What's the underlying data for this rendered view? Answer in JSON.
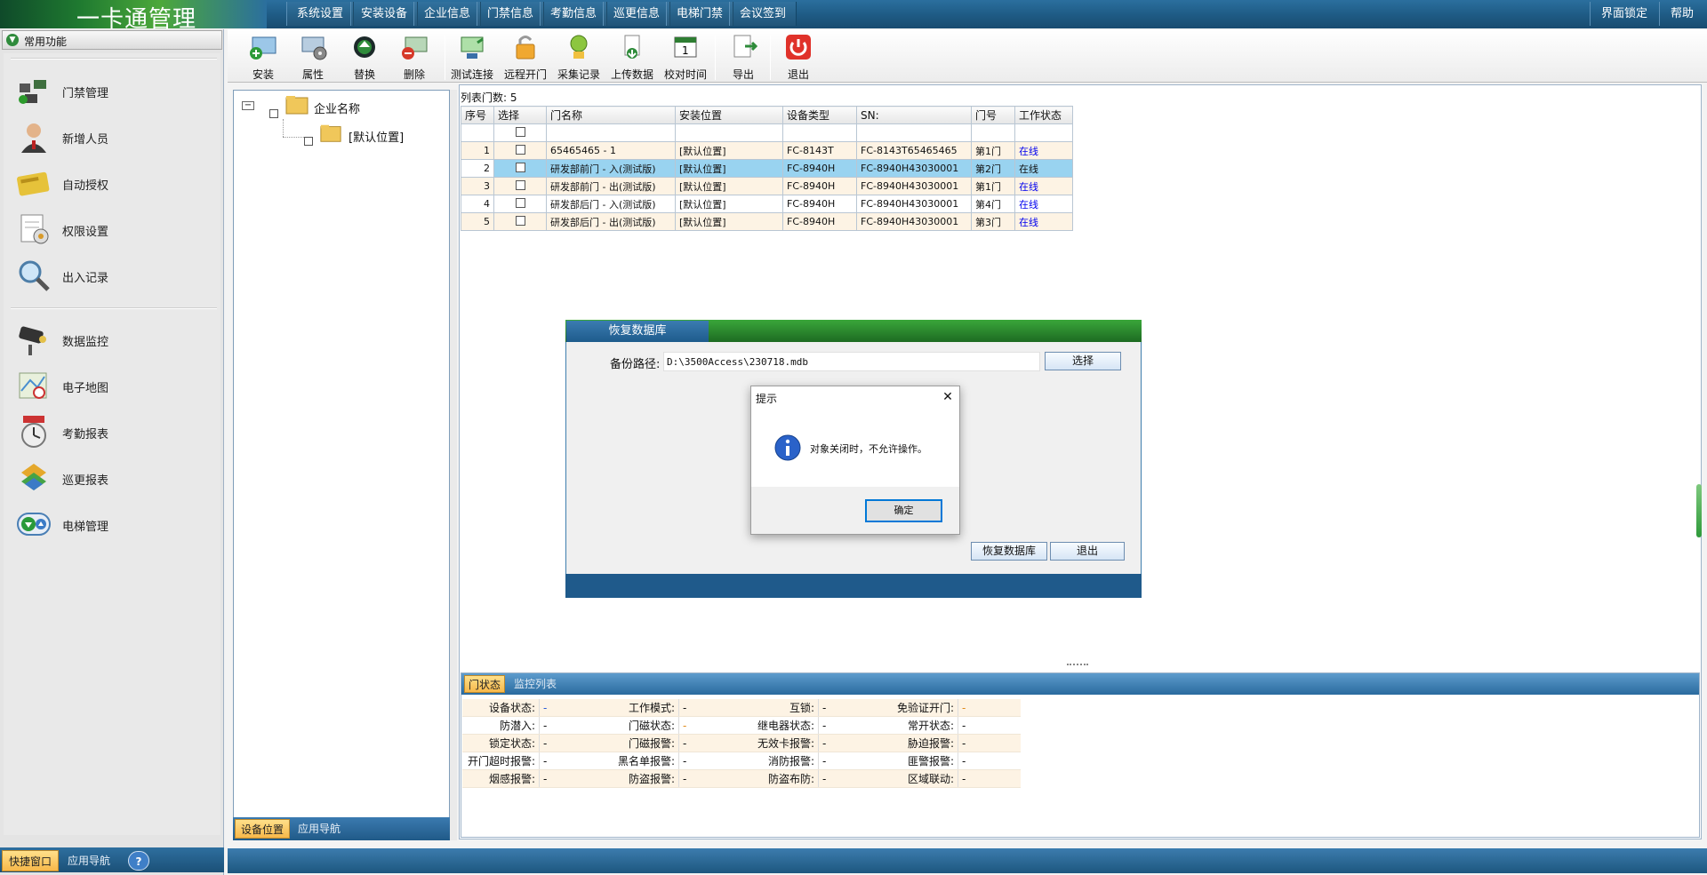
{
  "app": {
    "title": "一卡通管理"
  },
  "topmenu": [
    "系统设置",
    "安装设备",
    "企业信息",
    "门禁信息",
    "考勤信息",
    "巡更信息",
    "电梯门禁",
    "会议签到"
  ],
  "topright": [
    "界面锁定",
    "帮助"
  ],
  "sidebar": {
    "header": "常用功能",
    "items": [
      {
        "label": "门禁管理",
        "icon": "door-access-icon"
      },
      {
        "label": "新增人员",
        "icon": "person-icon"
      },
      {
        "label": "自动授权",
        "icon": "card-icon"
      },
      {
        "label": "权限设置",
        "icon": "permission-icon"
      },
      {
        "label": "出入记录",
        "icon": "magnifier-icon"
      },
      {
        "label": "数据监控",
        "icon": "camera-icon"
      },
      {
        "label": "电子地图",
        "icon": "map-icon"
      },
      {
        "label": "考勤报表",
        "icon": "clock-icon"
      },
      {
        "label": "巡更报表",
        "icon": "patrol-icon"
      },
      {
        "label": "电梯管理",
        "icon": "elevator-icon"
      }
    ],
    "bottom_tabs": [
      "快捷窗口",
      "应用导航"
    ],
    "help": "?"
  },
  "toolbar": [
    {
      "label": "安装",
      "icon": "install-icon"
    },
    {
      "label": "属性",
      "icon": "properties-icon"
    },
    {
      "label": "替换",
      "icon": "replace-icon"
    },
    {
      "label": "删除",
      "icon": "delete-icon"
    },
    {
      "label": "测试连接",
      "icon": "test-connection-icon"
    },
    {
      "label": "远程开门",
      "icon": "remote-open-icon"
    },
    {
      "label": "采集记录",
      "icon": "collect-icon"
    },
    {
      "label": "上传数据",
      "icon": "upload-icon"
    },
    {
      "label": "校对时间",
      "icon": "calendar-icon"
    },
    {
      "label": "导出",
      "icon": "export-icon"
    },
    {
      "label": "退出",
      "icon": "power-icon"
    }
  ],
  "tree": {
    "root": "企业名称",
    "child": "[默认位置]",
    "tabs": [
      "设备位置",
      "应用导航"
    ]
  },
  "list": {
    "count_label": "列表门数: 5",
    "headers": [
      "序号",
      "选择",
      "门名称",
      "安装位置",
      "设备类型",
      "SN:",
      "门号",
      "工作状态"
    ],
    "rows": [
      {
        "no": "1",
        "name": "65465465 - 1",
        "loc": "[默认位置]",
        "type": "FC-8143T",
        "sn": "FC-8143T65465465",
        "door": "第1门",
        "status": "在线"
      },
      {
        "no": "2",
        "name": "研发部前门 - 入(测试版)",
        "loc": "[默认位置]",
        "type": "FC-8940H",
        "sn": "FC-8940H43030001",
        "door": "第2门",
        "status": "在线"
      },
      {
        "no": "3",
        "name": "研发部前门 - 出(测试版)",
        "loc": "[默认位置]",
        "type": "FC-8940H",
        "sn": "FC-8940H43030001",
        "door": "第1门",
        "status": "在线"
      },
      {
        "no": "4",
        "name": "研发部后门 - 入(测试版)",
        "loc": "[默认位置]",
        "type": "FC-8940H",
        "sn": "FC-8940H43030001",
        "door": "第4门",
        "status": "在线"
      },
      {
        "no": "5",
        "name": "研发部后门 - 出(测试版)",
        "loc": "[默认位置]",
        "type": "FC-8940H",
        "sn": "FC-8940H43030001",
        "door": "第3门",
        "status": "在线"
      }
    ]
  },
  "status_panel": {
    "tabs": [
      "门状态",
      "监控列表"
    ],
    "rows": [
      [
        [
          "设备状态:",
          "-"
        ],
        [
          "工作模式:",
          "-"
        ],
        [
          "互锁:",
          "-"
        ],
        [
          "免验证开门:",
          "-"
        ]
      ],
      [
        [
          "防潜入:",
          "-"
        ],
        [
          "门磁状态:",
          "-"
        ],
        [
          "继电器状态:",
          "-"
        ],
        [
          "常开状态:",
          "-"
        ]
      ],
      [
        [
          "锁定状态:",
          "-"
        ],
        [
          "门磁报警:",
          "-"
        ],
        [
          "无效卡报警:",
          "-"
        ],
        [
          "胁迫报警:",
          "-"
        ]
      ],
      [
        [
          "开门超时报警:",
          "-"
        ],
        [
          "黑名单报警:",
          "-"
        ],
        [
          "消防报警:",
          "-"
        ],
        [
          "匪警报警:",
          "-"
        ]
      ],
      [
        [
          "烟感报警:",
          "-"
        ],
        [
          "防盗报警:",
          "-"
        ],
        [
          "防盗布防:",
          "-"
        ],
        [
          "区域联动:",
          "-"
        ]
      ]
    ]
  },
  "restore_dialog": {
    "title": "恢复数据库",
    "path_label": "备份路径:",
    "path_value": "D:\\3500Access\\230718.mdb",
    "select_btn": "选择",
    "restore_btn": "恢复数据库",
    "exit_btn": "退出"
  },
  "msgbox": {
    "title": "提示",
    "message": "对象关闭时，不允许操作。",
    "ok": "确定",
    "close": "✕"
  }
}
